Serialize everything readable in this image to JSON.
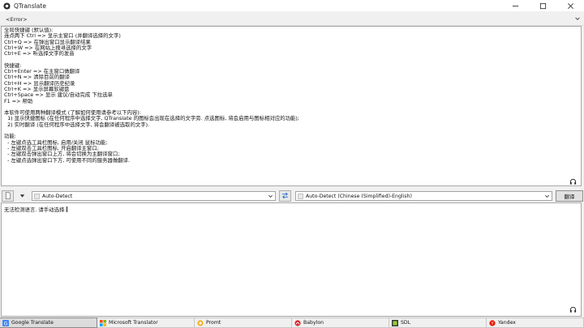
{
  "window": {
    "title": "QTranslate",
    "minimize": "—",
    "maximize": "☐",
    "close": "✕"
  },
  "error_bar": {
    "label": "<Error>"
  },
  "result": {
    "text": "全局快捷键 (默认值):\n连点两下 Ctrl => 显示主窗口 (并翻译选择的文字)\nCtrl+Q => 在弹出窗口显示翻译结果\nCtrl+W => 在网站上搜寻选择的文字\nCtrl+E => 听选择文字的发音\n\n快捷键:\nCtrl+Enter => 在主窗口做翻译\nCtrl+N => 清除目前的翻译\nCtrl+H => 显示翻译历史纪录\nCtrl+K => 显示屏幕软键盘\nCtrl+Space => 显示 建议/自动完成 下拉选单\nF1 => 帮助\n\n本软件可使用两种翻译模式 (了解如何使用请参考以下内容):\n  1) 显示快捷图标 (在任何程序中选择文字, QTranslate 的图标会出现在选择的文字旁. 点选图标, 将会启用与图标相对应的功能);\n  2) 实时翻译 (在任何程序中选择文字, 将会翻译被选取的文字).\n\n功能:\n  - 左键点选工具栏图标, 启用/关闭 鼠标功能;\n  - 左键双击工具栏图标, 开启翻译主窗口;\n  - 左键双击弹出窗口上方, 将会切换为主翻译窗口;\n  - 左键点选弹出窗口下方, 可使用不同的服务器做翻译."
  },
  "toolbar": {
    "source_language": "Auto-Detect",
    "target_language": "Auto-Detect (Chinese (Simplified)-English)",
    "translate_label": "翻译"
  },
  "source": {
    "text": "无法检测语言. 请手动选择."
  },
  "services": [
    {
      "label": "Google Translate",
      "icon": "google-icon",
      "color": "#4285f4",
      "active": true
    },
    {
      "label": "Microsoft Translator",
      "icon": "microsoft-icon",
      "color": "#00a4ef"
    },
    {
      "label": "Promt",
      "icon": "promt-icon",
      "color": "#f2b01e"
    },
    {
      "label": "Babylon",
      "icon": "babylon-icon",
      "color": "#d9232d"
    },
    {
      "label": "SDL",
      "icon": "sdl-icon",
      "color": "#3a3a3a"
    },
    {
      "label": "Yandex",
      "icon": "yandex-icon",
      "color": "#e61400"
    }
  ]
}
